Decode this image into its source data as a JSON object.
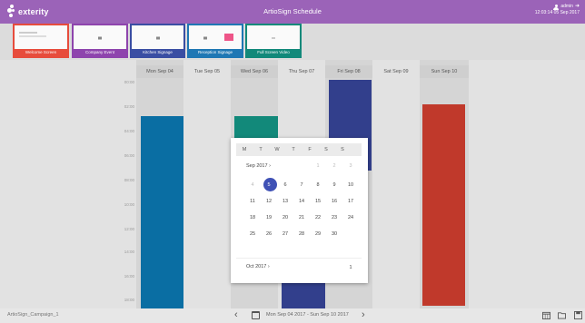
{
  "header": {
    "logo_text": "exterity",
    "title": "ArtioSign Schedule",
    "user": "admin",
    "datetime": "12:03:14 05 Sep 2017",
    "bg_color": "#9b63b8"
  },
  "thumbnails": [
    {
      "label": "Welcome Screen",
      "color": "#e74c3c"
    },
    {
      "label": "Company Event",
      "color": "#8e44ad"
    },
    {
      "label": "Kitchen Signage",
      "color": "#3a4ea3"
    },
    {
      "label": "Reception Signage",
      "color": "#1f77b4"
    },
    {
      "label": "Full Screen Video",
      "color": "#12897a"
    }
  ],
  "days": [
    "Mon Sep 04",
    "Tue Sep 05",
    "Wed Sep 06",
    "Thu Sep 07",
    "Fri Sep 08",
    "Sat Sep 09",
    "Sun Sep 10"
  ],
  "times": [
    "00:00",
    "02:00",
    "04:00",
    "06:00",
    "08:00",
    "10:00",
    "12:00",
    "14:00",
    "16:00",
    "18:00"
  ],
  "events": [
    {
      "day": "Mon Sep 04",
      "color": "#0a6ea3"
    },
    {
      "day": "Wed Sep 06",
      "color": "#12897a"
    },
    {
      "day": "Thu Sep 07",
      "color": "#323f8c"
    },
    {
      "day": "Fri Sep 08",
      "color": "#323f8c"
    },
    {
      "day": "Sun Sep 10",
      "color": "#c0392b"
    }
  ],
  "datepicker": {
    "weekday_headers": [
      "M",
      "T",
      "W",
      "T",
      "F",
      "S",
      "S"
    ],
    "month1_label": "Sep 2017",
    "month1_arrow": "›",
    "month1_first_row": [
      "1",
      "2",
      "3"
    ],
    "month1_weeks": [
      [
        "4",
        "5",
        "6",
        "7",
        "8",
        "9",
        "10"
      ],
      [
        "11",
        "12",
        "13",
        "14",
        "15",
        "16",
        "17"
      ],
      [
        "18",
        "19",
        "20",
        "21",
        "22",
        "23",
        "24"
      ],
      [
        "25",
        "26",
        "27",
        "28",
        "29",
        "30"
      ]
    ],
    "selected_day": "5",
    "month2_label": "Oct 2017",
    "month2_arrow": "›",
    "month2_first_day": "1",
    "accent": "#3f51b5"
  },
  "footer": {
    "campaign": "ArtioSign_Campaign_1",
    "range": "Mon Sep 04 2017 - Sun Sep 10 2017",
    "prev": "‹",
    "next": "›"
  }
}
